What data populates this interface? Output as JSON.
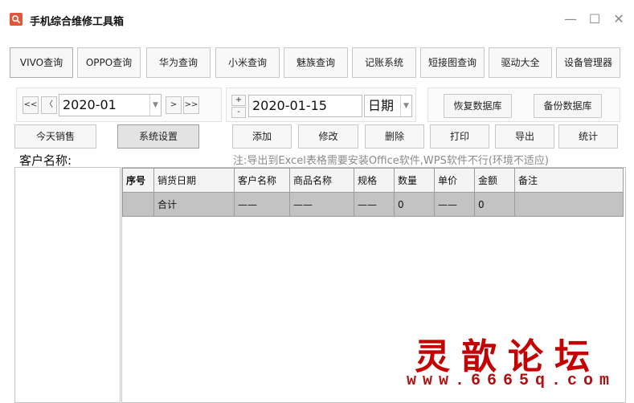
{
  "window": {
    "title": "手机综合维修工具箱",
    "minimize": "—",
    "maximize": "☐",
    "close": "✕"
  },
  "toolbar": {
    "items": [
      "VIVO查询",
      "OPPO查询",
      "华为查询",
      "小米查询",
      "魅族查询",
      "记账系统",
      "短接图查询",
      "驱动大全",
      "设备管理器"
    ]
  },
  "month_nav": {
    "first": "<<",
    "prev": "〈",
    "value": "2020-01",
    "next": ">",
    "last": ">>"
  },
  "date_picker": {
    "plus": "+",
    "minus": "-",
    "value": "2020-01-15",
    "mode": "日期"
  },
  "backup": {
    "restore": "恢复数据库",
    "backup": "备份数据库"
  },
  "actions": {
    "today_sales": "今天销售",
    "settings": "系统设置",
    "add": "添加",
    "edit": "修改",
    "delete": "删除",
    "print": "打印",
    "export": "导出",
    "stats": "统计"
  },
  "customer_label": "客户名称:",
  "export_note": "注:导出到Excel表格需要安装Office软件,WPS软件不行(环境不适应)",
  "table": {
    "headers": [
      "序号",
      "销货日期",
      "客户名称",
      "商品名称",
      "规格",
      "数量",
      "单价",
      "金额",
      "备注"
    ],
    "summary_row": [
      "",
      "合计",
      "——",
      "——",
      "——",
      "0",
      "——",
      "0",
      ""
    ]
  },
  "watermark": {
    "text": "灵歆论坛",
    "url": "www.6665q.com"
  },
  "colors": {
    "watermark": "#c40000",
    "icon": "#e2573a",
    "summary_row_bg": "#c3c3c3"
  }
}
